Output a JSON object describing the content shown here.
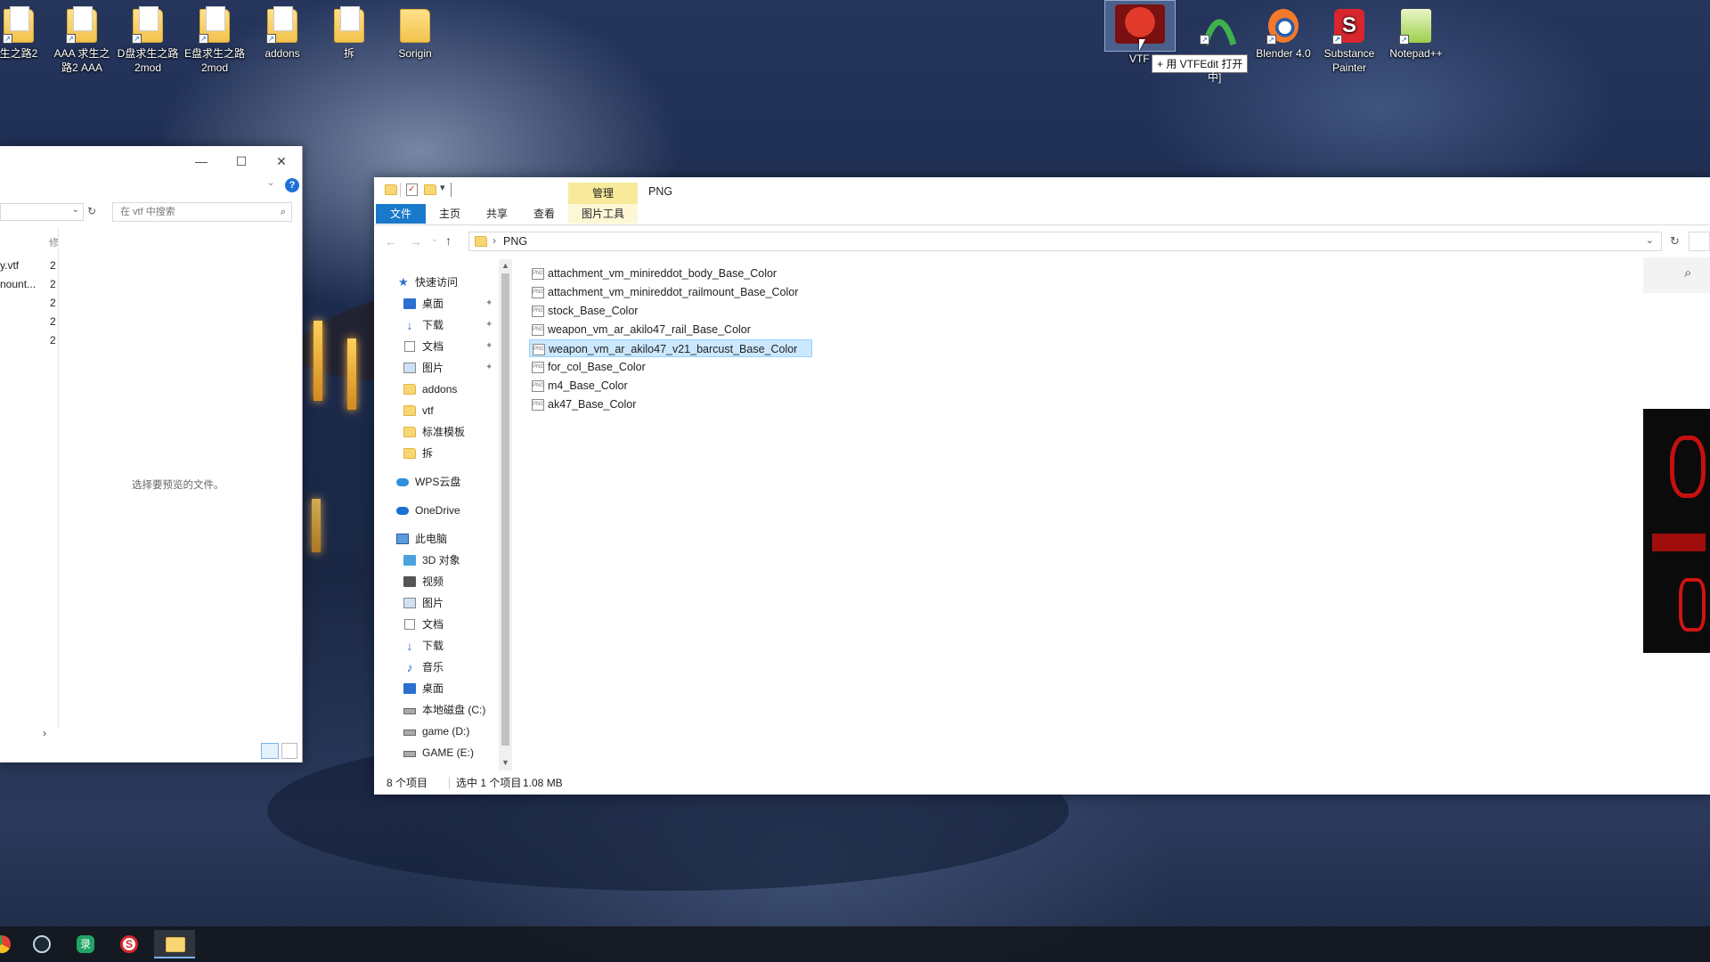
{
  "desktop": {
    "icons": [
      {
        "label": "生之路2",
        "kind": "folder"
      },
      {
        "label": "AAA 求生之路2 AAA",
        "kind": "folder"
      },
      {
        "label": "D盘求生之路2mod",
        "kind": "folder"
      },
      {
        "label": "E盘求生之路2mod",
        "kind": "folder"
      },
      {
        "label": "addons",
        "kind": "folder"
      },
      {
        "label": "拆",
        "kind": "folder"
      },
      {
        "label": "Sorigin",
        "kind": "folder"
      },
      {
        "label": "VTF",
        "kind": "app"
      },
      {
        "label": "",
        "kind": "app"
      },
      {
        "label": "Blender 4.0",
        "kind": "app"
      },
      {
        "label": "Substance Painter",
        "kind": "app"
      },
      {
        "label": "Notepad++",
        "kind": "app"
      }
    ],
    "drag_tooltip": "+ 用 VTFEdit 打开",
    "drag_tooltip_tail": "中]"
  },
  "left_window": {
    "search_placeholder": "在 vtf 中搜索",
    "col_header": "修",
    "files": [
      {
        "name": "y.vtf",
        "val": "2"
      },
      {
        "name": "nount...",
        "val": "2"
      },
      {
        "name": "",
        "val": "2"
      },
      {
        "name": "",
        "val": "2"
      },
      {
        "name": "",
        "val": "2"
      }
    ],
    "preview_text": "选择要预览的文件。",
    "help": "?"
  },
  "main_window": {
    "quick_access_dropdown": "▾",
    "context_tab": "管理",
    "title": "PNG",
    "ribbon_tabs": [
      "文件",
      "主页",
      "共享",
      "查看",
      "图片工具"
    ],
    "address_path": "PNG",
    "address_sep": "›",
    "nav": {
      "quick_access": "快速访问",
      "pinned": [
        {
          "label": "桌面",
          "icon": "desktop-icon",
          "pinned": true
        },
        {
          "label": "下载",
          "icon": "download-icon",
          "pinned": true
        },
        {
          "label": "文档",
          "icon": "document-icon",
          "pinned": true
        },
        {
          "label": "图片",
          "icon": "pictures-icon",
          "pinned": true
        },
        {
          "label": "addons",
          "icon": "folder-icon",
          "pinned": false
        },
        {
          "label": "vtf",
          "icon": "folder-icon",
          "pinned": false
        },
        {
          "label": "标准模板",
          "icon": "folder-icon",
          "pinned": false
        },
        {
          "label": "拆",
          "icon": "folder-icon",
          "pinned": false
        }
      ],
      "wps": "WPS云盘",
      "onedrive": "OneDrive",
      "this_pc": "此电脑",
      "pc_items": [
        {
          "label": "3D 对象",
          "icon": "3d-objects-icon"
        },
        {
          "label": "视频",
          "icon": "videos-icon"
        },
        {
          "label": "图片",
          "icon": "pictures-icon"
        },
        {
          "label": "文档",
          "icon": "document-icon"
        },
        {
          "label": "下载",
          "icon": "download-icon"
        },
        {
          "label": "音乐",
          "icon": "music-icon"
        },
        {
          "label": "桌面",
          "icon": "desktop-icon"
        },
        {
          "label": "本地磁盘 (C:)",
          "icon": "drive-icon"
        },
        {
          "label": "game (D:)",
          "icon": "drive-icon"
        },
        {
          "label": "GAME (E:)",
          "icon": "drive-icon"
        }
      ]
    },
    "files": [
      {
        "name": "attachment_vm_minireddot_body_Base_Color",
        "selected": false
      },
      {
        "name": "attachment_vm_minireddot_railmount_Base_Color",
        "selected": false
      },
      {
        "name": "stock_Base_Color",
        "selected": false
      },
      {
        "name": "weapon_vm_ar_akilo47_rail_Base_Color",
        "selected": false
      },
      {
        "name": "weapon_vm_ar_akilo47_v21_barcust_Base_Color",
        "selected": true
      },
      {
        "name": "for_col_Base_Color",
        "selected": false
      },
      {
        "name": "m4_Base_Color",
        "selected": false
      },
      {
        "name": "ak47_Base_Color",
        "selected": false
      }
    ],
    "file_icon_text": "PNG",
    "status": {
      "count": "8 个项目",
      "selected": "选中 1 个项目",
      "size": "1.08 MB"
    }
  },
  "taskbar": {
    "apps": [
      "chrome",
      "steam",
      "recorder",
      "substance-painter",
      "file-explorer"
    ]
  },
  "colors": {
    "selection": "#cce8ff",
    "ribbon_file_tab": "#1979ca",
    "context_tab": "#f7ea9a"
  }
}
